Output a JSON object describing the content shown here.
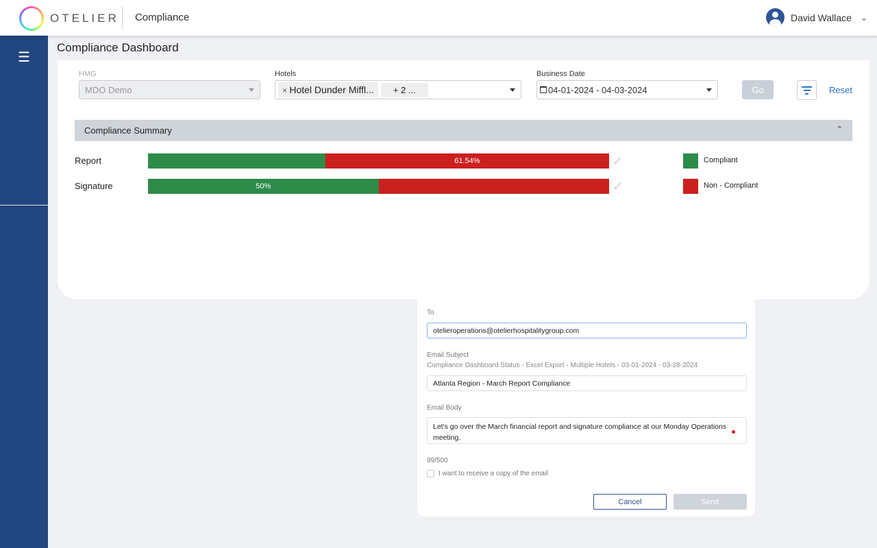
{
  "header": {
    "logo": "OTELIER",
    "app_title": "Compliance",
    "user_name": "David Wallace"
  },
  "page": {
    "title": "Compliance Dashboard"
  },
  "filters": {
    "hmg": {
      "label": "HMG",
      "value": "MDO Demo"
    },
    "hotels": {
      "label": "Hotels",
      "chip": "Hotel Dunder Miffl...",
      "more": "+ 2 ..."
    },
    "business_date": {
      "label": "Business Date",
      "value": "04-01-2024 - 04-03-2024"
    },
    "go_label": "Go",
    "reset_label": "Reset"
  },
  "summary": {
    "title": "Compliance Summary",
    "rows": [
      {
        "label": "Report",
        "compliant_pct": 38.46,
        "noncompliant_pct": 61.54,
        "text": "61.54%"
      },
      {
        "label": "Signature",
        "compliant_pct": 50,
        "noncompliant_pct": 50,
        "text": "50%"
      }
    ],
    "legend": [
      {
        "label": "Compliant",
        "color": "#2e8b4a"
      },
      {
        "label": "Non - Compliant",
        "color": "#cc1f1f"
      }
    ]
  },
  "email": {
    "to_label": "To",
    "to_value": "otelieroperations@otelierhospitalitygroup.com",
    "subject_label": "Email Subject",
    "subject_default": "Compliance Dashboard Status - Excel Export - Multiple Hotels - 03-01-2024 - 03-28-2024",
    "subject_value": "Atlanta Region - March Report Compliance",
    "body_label": "Email Body",
    "body_value": "Let's go over the March financial report and signature compliance at our Monday Operations meeting.",
    "char_count": "99/500",
    "copy_label": "I want to receive a copy of the email",
    "cancel_label": "Cancel",
    "send_label": "Send"
  }
}
